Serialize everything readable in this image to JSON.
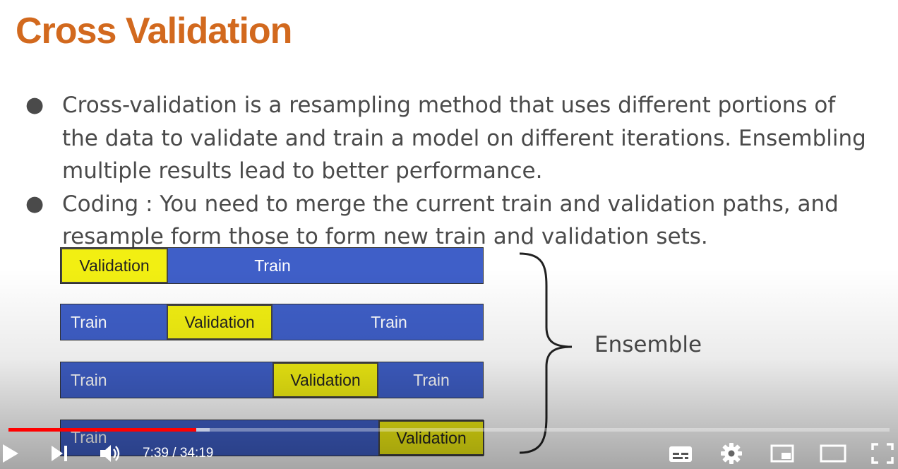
{
  "slide": {
    "title": "Cross Validation",
    "bullets": [
      {
        "lines": [
          "Cross-validation is a resampling method that uses different portions of",
          "the data to validate and train a model on different iterations. Ensembling",
          "multiple results lead to better performance."
        ]
      },
      {
        "lines": [
          "Coding : You need to merge the current train and validation paths, and",
          "resample form those to form new train and validation sets."
        ]
      }
    ],
    "folds": [
      [
        {
          "label": "Validation",
          "kind": "validation"
        },
        {
          "label": "Train",
          "kind": "train"
        }
      ],
      [
        {
          "label": "Train",
          "kind": "train"
        },
        {
          "label": "Validation",
          "kind": "validation"
        },
        {
          "label": "Train",
          "kind": "train"
        }
      ],
      [
        {
          "label": "Train",
          "kind": "train"
        },
        {
          "label": "Validation",
          "kind": "validation"
        },
        {
          "label": "Train",
          "kind": "train"
        }
      ],
      [
        {
          "label": "Train",
          "kind": "train"
        },
        {
          "label": "Validation",
          "kind": "validation"
        }
      ]
    ],
    "ensemble_label": "Ensemble",
    "colors": {
      "title": "#d2691e",
      "train": "#3f5fc8",
      "validation": "#f2ef12"
    }
  },
  "player": {
    "progress_played": 0.213,
    "progress_loaded": 0.228,
    "time_display": "7:39 / 34:19",
    "buttons": {
      "play": "play-icon",
      "next": "next-icon",
      "volume": "volume-icon",
      "subtitles": "subtitles-icon",
      "settings": "gear-icon",
      "miniplayer": "miniplayer-icon",
      "theater": "theater-mode-icon",
      "fullscreen": "fullscreen-icon"
    },
    "colors": {
      "played": "#ff0000"
    }
  }
}
